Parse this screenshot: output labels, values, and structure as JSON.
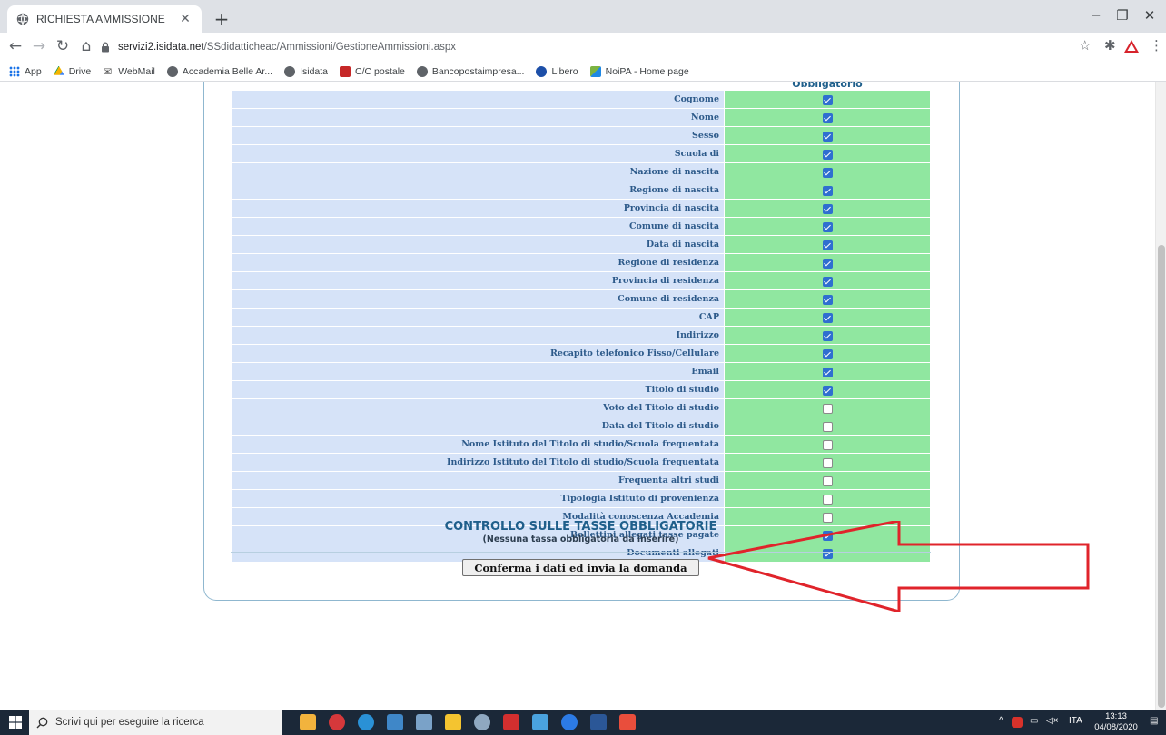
{
  "browser": {
    "tab_title": "RICHIESTA AMMISSIONE",
    "url_host": "servizi2.isidata.net",
    "url_path": "/SSdidatticheac/Ammissioni/GestioneAmmissioni.aspx",
    "bookmarks": [
      "App",
      "Drive",
      "WebMail",
      "Accademia Belle Ar...",
      "Isidata",
      "C/C postale",
      "Bancopostaimpresa...",
      "Libero",
      "NoiPA - Home page"
    ]
  },
  "form": {
    "column_header": "Obbligatorio",
    "fields": [
      {
        "label": "Cognome",
        "checked": true
      },
      {
        "label": "Nome",
        "checked": true
      },
      {
        "label": "Sesso",
        "checked": true
      },
      {
        "label": "Scuola di",
        "checked": true
      },
      {
        "label": "Nazione di nascita",
        "checked": true
      },
      {
        "label": "Regione di nascita",
        "checked": true
      },
      {
        "label": "Provincia di nascita",
        "checked": true
      },
      {
        "label": "Comune di nascita",
        "checked": true
      },
      {
        "label": "Data di nascita",
        "checked": true
      },
      {
        "label": "Regione di residenza",
        "checked": true
      },
      {
        "label": "Provincia di residenza",
        "checked": true
      },
      {
        "label": "Comune di residenza",
        "checked": true
      },
      {
        "label": "CAP",
        "checked": true
      },
      {
        "label": "Indirizzo",
        "checked": true
      },
      {
        "label": "Recapito telefonico Fisso/Cellulare",
        "checked": true
      },
      {
        "label": "Email",
        "checked": true
      },
      {
        "label": "Titolo di studio",
        "checked": true
      },
      {
        "label": "Voto del Titolo di studio",
        "checked": false
      },
      {
        "label": "Data del Titolo di studio",
        "checked": false
      },
      {
        "label": "Nome Istituto del Titolo di studio/Scuola frequentata",
        "checked": false
      },
      {
        "label": "Indirizzo Istituto del Titolo di studio/Scuola frequentata",
        "checked": false
      },
      {
        "label": "Frequenta altri studi",
        "checked": false
      },
      {
        "label": "Tipologia Istituto di provenienza",
        "checked": false
      },
      {
        "label": "Modalità conoscenza Accademia",
        "checked": false
      },
      {
        "label": "Bollettini allegati tasse pagate",
        "checked": true
      },
      {
        "label": "Documenti allegati",
        "checked": true
      }
    ],
    "taxes_title": "CONTROLLO SULLE TASSE OBBLIGATORIE",
    "taxes_subtitle": "(Nessuna tassa obbligatoria da inserire)",
    "confirm_button": "Conferma i dati ed invia la domanda"
  },
  "annotation": {
    "arrow_color": "#e0242b"
  },
  "taskbar": {
    "search_placeholder": "Scrivi qui per eseguire la ricerca",
    "language": "ITA",
    "time": "13:13",
    "date": "04/08/2020"
  },
  "colors": {
    "label_bg": "#d6e3f8",
    "check_bg": "#90e7a0",
    "heading": "#1f5f8b"
  }
}
